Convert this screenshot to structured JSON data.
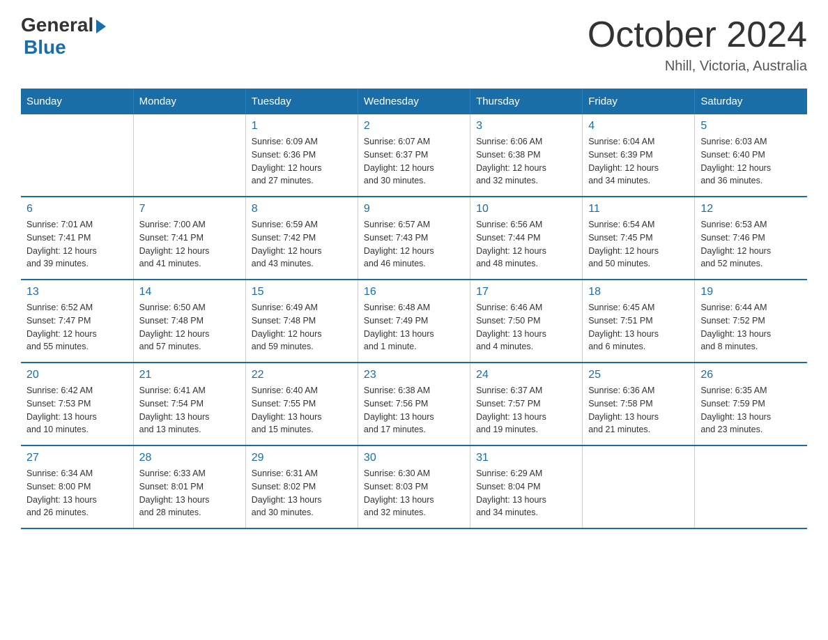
{
  "header": {
    "logo": {
      "general": "General",
      "blue": "Blue"
    },
    "title": "October 2024",
    "subtitle": "Nhill, Victoria, Australia"
  },
  "days_of_week": [
    "Sunday",
    "Monday",
    "Tuesday",
    "Wednesday",
    "Thursday",
    "Friday",
    "Saturday"
  ],
  "weeks": [
    {
      "days": [
        {
          "number": "",
          "info": ""
        },
        {
          "number": "",
          "info": ""
        },
        {
          "number": "1",
          "info": "Sunrise: 6:09 AM\nSunset: 6:36 PM\nDaylight: 12 hours\nand 27 minutes."
        },
        {
          "number": "2",
          "info": "Sunrise: 6:07 AM\nSunset: 6:37 PM\nDaylight: 12 hours\nand 30 minutes."
        },
        {
          "number": "3",
          "info": "Sunrise: 6:06 AM\nSunset: 6:38 PM\nDaylight: 12 hours\nand 32 minutes."
        },
        {
          "number": "4",
          "info": "Sunrise: 6:04 AM\nSunset: 6:39 PM\nDaylight: 12 hours\nand 34 minutes."
        },
        {
          "number": "5",
          "info": "Sunrise: 6:03 AM\nSunset: 6:40 PM\nDaylight: 12 hours\nand 36 minutes."
        }
      ]
    },
    {
      "days": [
        {
          "number": "6",
          "info": "Sunrise: 7:01 AM\nSunset: 7:41 PM\nDaylight: 12 hours\nand 39 minutes."
        },
        {
          "number": "7",
          "info": "Sunrise: 7:00 AM\nSunset: 7:41 PM\nDaylight: 12 hours\nand 41 minutes."
        },
        {
          "number": "8",
          "info": "Sunrise: 6:59 AM\nSunset: 7:42 PM\nDaylight: 12 hours\nand 43 minutes."
        },
        {
          "number": "9",
          "info": "Sunrise: 6:57 AM\nSunset: 7:43 PM\nDaylight: 12 hours\nand 46 minutes."
        },
        {
          "number": "10",
          "info": "Sunrise: 6:56 AM\nSunset: 7:44 PM\nDaylight: 12 hours\nand 48 minutes."
        },
        {
          "number": "11",
          "info": "Sunrise: 6:54 AM\nSunset: 7:45 PM\nDaylight: 12 hours\nand 50 minutes."
        },
        {
          "number": "12",
          "info": "Sunrise: 6:53 AM\nSunset: 7:46 PM\nDaylight: 12 hours\nand 52 minutes."
        }
      ]
    },
    {
      "days": [
        {
          "number": "13",
          "info": "Sunrise: 6:52 AM\nSunset: 7:47 PM\nDaylight: 12 hours\nand 55 minutes."
        },
        {
          "number": "14",
          "info": "Sunrise: 6:50 AM\nSunset: 7:48 PM\nDaylight: 12 hours\nand 57 minutes."
        },
        {
          "number": "15",
          "info": "Sunrise: 6:49 AM\nSunset: 7:48 PM\nDaylight: 12 hours\nand 59 minutes."
        },
        {
          "number": "16",
          "info": "Sunrise: 6:48 AM\nSunset: 7:49 PM\nDaylight: 13 hours\nand 1 minute."
        },
        {
          "number": "17",
          "info": "Sunrise: 6:46 AM\nSunset: 7:50 PM\nDaylight: 13 hours\nand 4 minutes."
        },
        {
          "number": "18",
          "info": "Sunrise: 6:45 AM\nSunset: 7:51 PM\nDaylight: 13 hours\nand 6 minutes."
        },
        {
          "number": "19",
          "info": "Sunrise: 6:44 AM\nSunset: 7:52 PM\nDaylight: 13 hours\nand 8 minutes."
        }
      ]
    },
    {
      "days": [
        {
          "number": "20",
          "info": "Sunrise: 6:42 AM\nSunset: 7:53 PM\nDaylight: 13 hours\nand 10 minutes."
        },
        {
          "number": "21",
          "info": "Sunrise: 6:41 AM\nSunset: 7:54 PM\nDaylight: 13 hours\nand 13 minutes."
        },
        {
          "number": "22",
          "info": "Sunrise: 6:40 AM\nSunset: 7:55 PM\nDaylight: 13 hours\nand 15 minutes."
        },
        {
          "number": "23",
          "info": "Sunrise: 6:38 AM\nSunset: 7:56 PM\nDaylight: 13 hours\nand 17 minutes."
        },
        {
          "number": "24",
          "info": "Sunrise: 6:37 AM\nSunset: 7:57 PM\nDaylight: 13 hours\nand 19 minutes."
        },
        {
          "number": "25",
          "info": "Sunrise: 6:36 AM\nSunset: 7:58 PM\nDaylight: 13 hours\nand 21 minutes."
        },
        {
          "number": "26",
          "info": "Sunrise: 6:35 AM\nSunset: 7:59 PM\nDaylight: 13 hours\nand 23 minutes."
        }
      ]
    },
    {
      "days": [
        {
          "number": "27",
          "info": "Sunrise: 6:34 AM\nSunset: 8:00 PM\nDaylight: 13 hours\nand 26 minutes."
        },
        {
          "number": "28",
          "info": "Sunrise: 6:33 AM\nSunset: 8:01 PM\nDaylight: 13 hours\nand 28 minutes."
        },
        {
          "number": "29",
          "info": "Sunrise: 6:31 AM\nSunset: 8:02 PM\nDaylight: 13 hours\nand 30 minutes."
        },
        {
          "number": "30",
          "info": "Sunrise: 6:30 AM\nSunset: 8:03 PM\nDaylight: 13 hours\nand 32 minutes."
        },
        {
          "number": "31",
          "info": "Sunrise: 6:29 AM\nSunset: 8:04 PM\nDaylight: 13 hours\nand 34 minutes."
        },
        {
          "number": "",
          "info": ""
        },
        {
          "number": "",
          "info": ""
        }
      ]
    }
  ]
}
